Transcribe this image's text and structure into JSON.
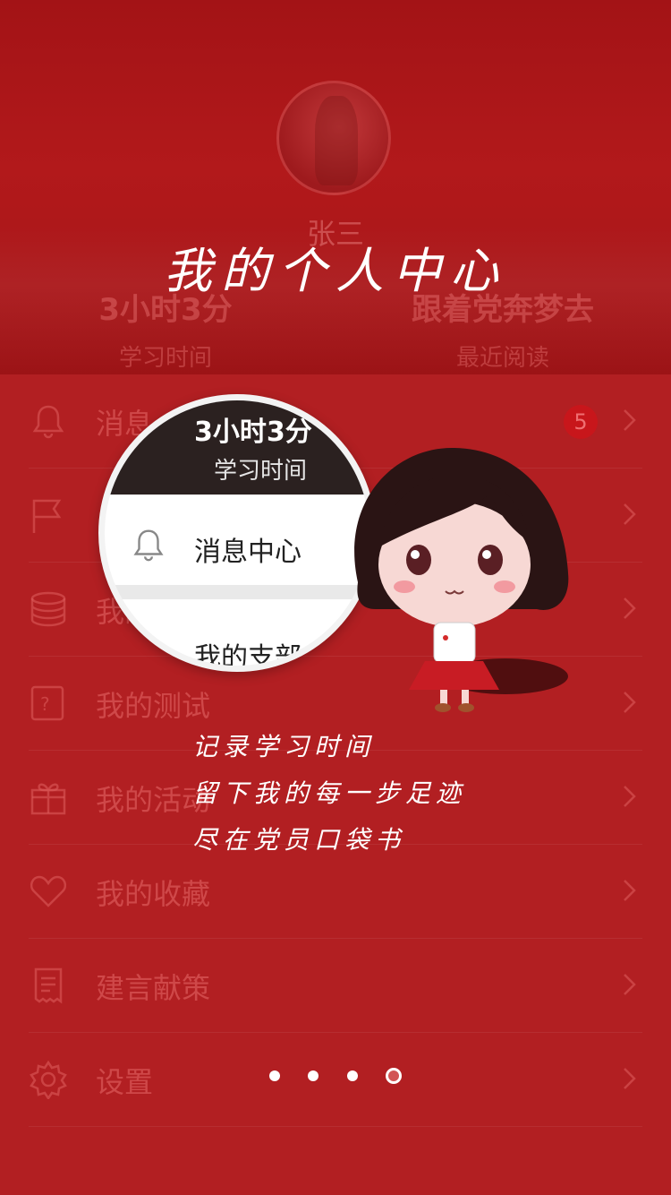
{
  "profile": {
    "name": "张三",
    "stats": [
      {
        "value": "3小时3分",
        "label": "学习时间"
      },
      {
        "value": "跟着党奔梦去",
        "label": "最近阅读"
      }
    ]
  },
  "banner": {
    "title": "我的个人中心",
    "lines": [
      "记录学习时间",
      "留下我的每一步足迹",
      "尽在党员口袋书"
    ]
  },
  "menu": {
    "items": [
      {
        "label": "消息",
        "icon": "bell-icon",
        "badge": "5"
      },
      {
        "label": "",
        "icon": "flag-icon"
      },
      {
        "label": "我的",
        "icon": "coins-icon"
      },
      {
        "label": "我的测试",
        "icon": "quiz-icon"
      },
      {
        "label": "我的活动",
        "icon": "gift-icon"
      },
      {
        "label": "我的收藏",
        "icon": "heart-icon"
      },
      {
        "label": "建言献策",
        "icon": "document-icon"
      },
      {
        "label": "设置",
        "icon": "gear-icon"
      }
    ]
  },
  "magnifier": {
    "time_value": "3小时3分",
    "time_label": "学习时间",
    "row1": "消息中心",
    "row2": "我的支部"
  },
  "pager": {
    "count": 4,
    "active_index": 3
  },
  "colors": {
    "brand_red": "#b21f22",
    "header_red": "#a31316",
    "badge_red": "#c8161b"
  }
}
